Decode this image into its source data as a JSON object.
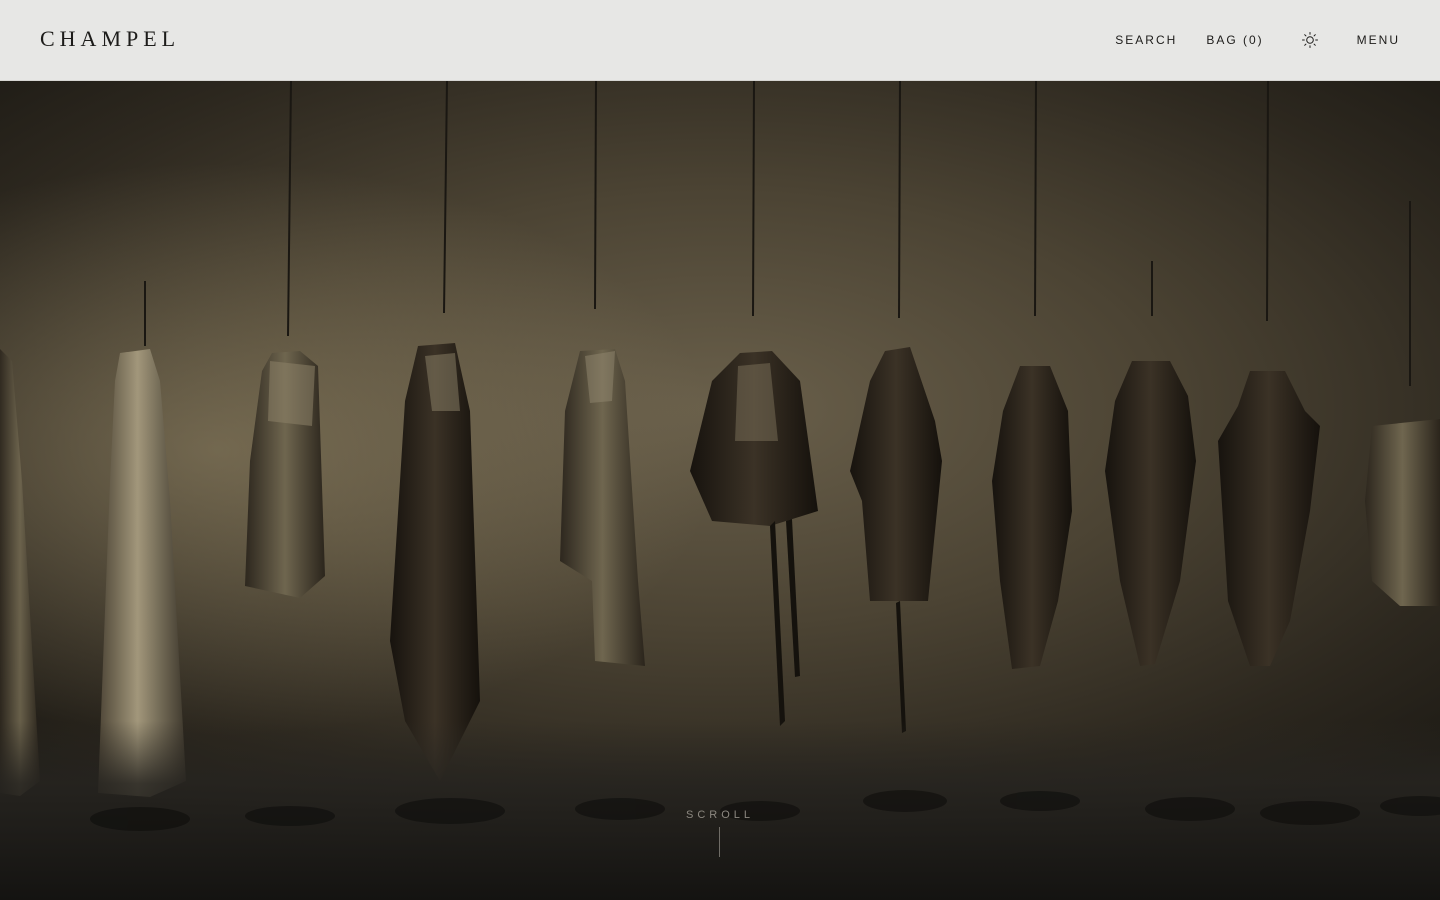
{
  "header": {
    "logo": "CHAMPEL",
    "nav": {
      "search": "SEARCH",
      "bag": "BAG (0)",
      "theme_icon": "sun-icon",
      "menu": "MENU"
    }
  },
  "hero": {
    "image_description_icon": "hanging-garments-image",
    "scroll_label": "SCROLL"
  },
  "colors": {
    "header_bg": "#e7e7e5",
    "text": "#1d1c1a",
    "hero_dark": "#1f1c16"
  }
}
